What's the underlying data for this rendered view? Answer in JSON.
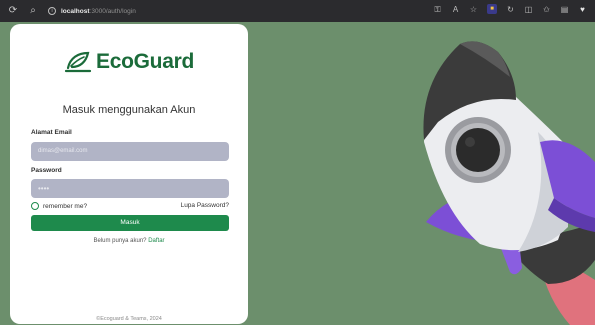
{
  "browser": {
    "url_host": "localhost",
    "url_path": ":3000/auth/login"
  },
  "brand": {
    "name": "EcoGuard",
    "color": "#1b6b3a",
    "accent": "#1e8a4c",
    "background": "#6c8f6c"
  },
  "login": {
    "heading": "Masuk menggunakan Akun",
    "email_label": "Alamat Email",
    "email_value": "dimas@email.com",
    "password_label": "Password",
    "password_value": "••••",
    "remember_label": "remember me?",
    "forgot_label": "Lupa Password?",
    "submit_label": "Masuk",
    "signup_prompt": "Belum punya akun?",
    "signup_link": "Daftar"
  },
  "footer": {
    "text": "©Ecoguard & Teams, 2024"
  }
}
